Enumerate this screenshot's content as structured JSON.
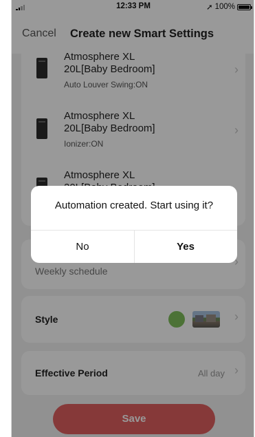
{
  "status_bar": {
    "time": "12:33 PM",
    "battery": "100%",
    "location_icon": "location-arrow-icon",
    "signal_icon": "signal-icon",
    "battery_icon": "battery-icon"
  },
  "nav": {
    "cancel_label": "Cancel",
    "title": "Create new Smart Settings"
  },
  "devices": [
    {
      "name_line1": "Atmosphere XL",
      "name_line2": "20L[Baby Bedroom]",
      "action": "Auto Louver Swing:ON"
    },
    {
      "name_line1": "Atmosphere XL",
      "name_line2": "20L[Baby Bedroom]",
      "action": "Ionizer:ON"
    },
    {
      "name_line1": "Atmosphere XL",
      "name_line2": "20L[Baby Bedroom]",
      "action": ""
    }
  ],
  "schedule": {
    "subtitle": "Weekly schedule"
  },
  "style": {
    "label": "Style",
    "color": "#7fbf5a"
  },
  "effective_period": {
    "label": "Effective Period",
    "value": "All day"
  },
  "save_label": "Save",
  "dialog": {
    "message": "Automation created. Start using it?",
    "no_label": "No",
    "yes_label": "Yes"
  },
  "chevron_glyph": "›",
  "colors": {
    "accent": "#e06060",
    "overlay": "rgba(0,0,0,0.40)"
  }
}
